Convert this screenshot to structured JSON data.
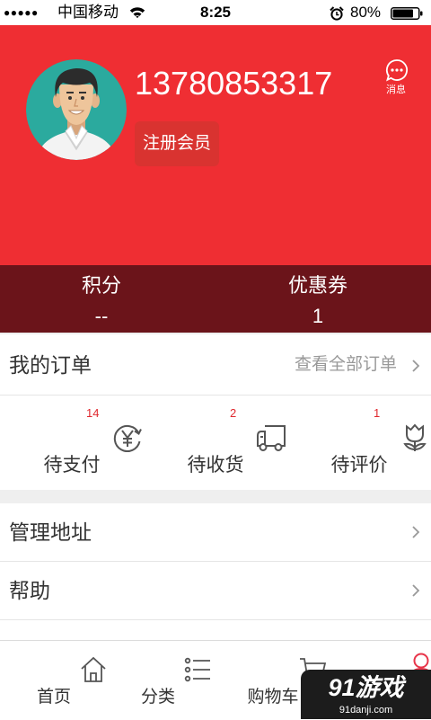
{
  "theme": {
    "header_bg": "#EF2E33",
    "band_bg": "#6B141A",
    "member_button_bg": "#D93330",
    "badge_color": "#E0282E",
    "active_tab_color": "#E8354A"
  },
  "status_bar": {
    "signal": "●●●●●",
    "carrier": "中国移动",
    "time": "8:25",
    "battery": "80%",
    "icons": [
      "wifi-icon",
      "alarm-icon",
      "battery-icon"
    ]
  },
  "profile": {
    "phone": "13780853317",
    "member_button": "注册会员",
    "message_label": "消息",
    "message_icon": "chat-bubble-icon",
    "avatar": "cartoon-man-avatar"
  },
  "stats": [
    {
      "label": "积分",
      "value": "--"
    },
    {
      "label": "优惠券",
      "value": "1"
    }
  ],
  "orders": {
    "title": "我的订单",
    "view_all": "查看全部订单",
    "items": [
      {
        "label": "待支付",
        "badge": "14",
        "icon": "yuan-icon"
      },
      {
        "label": "待收货",
        "badge": "2",
        "icon": "truck-icon"
      },
      {
        "label": "待评价",
        "badge": "1",
        "icon": "flower-icon"
      }
    ]
  },
  "menu": [
    {
      "label": "管理地址"
    },
    {
      "label": "帮助"
    }
  ],
  "tab_bar": [
    {
      "label": "首页",
      "icon": "home-icon"
    },
    {
      "label": "分类",
      "icon": "list-icon"
    },
    {
      "label": "购物车",
      "icon": "cart-icon"
    },
    {
      "icon": "person-icon",
      "active": true
    }
  ],
  "watermark": {
    "logo": "91游戏",
    "site": "91danji.com"
  }
}
